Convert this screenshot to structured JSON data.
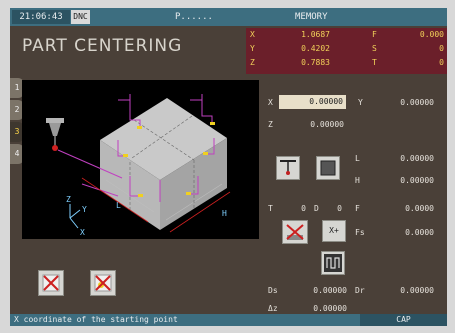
{
  "status_bar": {
    "clock": "21:06:43",
    "dnc": "DNC",
    "program": "P......",
    "mode": "MEMORY"
  },
  "title": "PART CENTERING",
  "position_display": {
    "rows": [
      {
        "axis": "X",
        "value": "1.0687",
        "param": "F",
        "param_value": "0.000"
      },
      {
        "axis": "Y",
        "value": "0.4202",
        "param": "S",
        "param_value": "0"
      },
      {
        "axis": "Z",
        "value": "0.7883",
        "param": "T",
        "param_value": "0"
      }
    ]
  },
  "side_tabs": [
    "1",
    "2",
    "3",
    "4"
  ],
  "active_tab": "3",
  "graphic": {
    "axes": {
      "z": "Z",
      "y": "Y",
      "x": "X"
    },
    "dims": {
      "l": "L",
      "h": "H"
    }
  },
  "fields": {
    "x_label": "X",
    "x_value": "0.00000",
    "y_label": "Y",
    "y_value": "0.00000",
    "z_label": "Z",
    "z_value": "0.00000",
    "l_label": "L",
    "l_value": "0.00000",
    "h_label": "H",
    "h_value": "0.00000",
    "t_label": "T",
    "t_value": "0",
    "d_label": "D",
    "d_value": "0",
    "f_label": "F",
    "f_value": "0.0000",
    "fs_label": "Fs",
    "fs_value": "0.0000",
    "ds_label": "Ds",
    "ds_value": "0.00000",
    "dr_label": "Dr",
    "dr_value": "0.00000",
    "dz_label": "Δz",
    "dz_value": "0.00000"
  },
  "buttons": {
    "x_plus": "X+"
  },
  "message": "X coordinate of the starting point",
  "caps": "CAP",
  "colors": {
    "background": "#4a4038",
    "topbar": "#3d6e80",
    "position_box": "#6b1f2a",
    "position_text": "#f2d25a",
    "tool_path": "#c040c0",
    "dimension": "#cc2020"
  }
}
